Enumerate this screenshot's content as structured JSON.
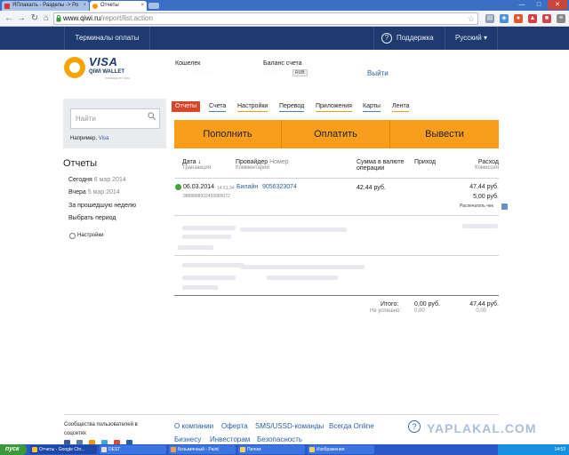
{
  "browser": {
    "tabs": [
      {
        "label": "ЯПлакалъ - Разделы -> Ро"
      },
      {
        "label": "Отчеты"
      }
    ],
    "url_host": "www.qiwi.ru",
    "url_path": "/report/list.action",
    "window_controls": {
      "minimize": "—",
      "maximize": "□",
      "close": "✕"
    }
  },
  "topbar": {
    "terminals": "Терминалы оплаты",
    "support": "Поддержка",
    "language": "Русский ▾"
  },
  "logo": {
    "brand": "VISA",
    "product": "QIWI WALLET",
    "powered": "POWERED BY QIWI"
  },
  "account": {
    "wallet_label": "Кошелек",
    "wallet_value": "· · · · · · ·",
    "balance_label": "Баланс счета",
    "balance_value": "· · · · ·",
    "currency": "RUB",
    "logout": "Выйти"
  },
  "search": {
    "placeholder": "Найти",
    "example_prefix": "Например,",
    "example_link": "Visa"
  },
  "left": {
    "heading": "Отчеты",
    "today": "Сегодня",
    "today_date": "6 мар 2014",
    "yesterday": "Вчера",
    "yesterday_date": "5 мар 2014",
    "last_week": "За прошедшую неделю",
    "choose_period": "Выбрать период",
    "settings": "Настройки"
  },
  "tabs": [
    "Отчеты",
    "Счета",
    "Настройки",
    "Перевод",
    "Приложения",
    "Карты",
    "Лента"
  ],
  "actions": {
    "topup": "Пополнить",
    "pay": "Оплатить",
    "withdraw": "Вывести"
  },
  "table": {
    "col_date": "Дата ↓",
    "col_date_sub": "Транзакция",
    "col_provider": "Провайдер",
    "col_provider_num": "Номер",
    "col_provider_sub": "Комментарий",
    "col_sum": "Сумма в валюте операции",
    "col_income": "Приход",
    "col_expense": "Расход",
    "col_expense_sub": "Комиссия",
    "row": {
      "date": "06.03.2014",
      "time": "14:51:34",
      "txn": "9888888002455886072",
      "provider": "Билайн",
      "number": "9056323074",
      "sum": "42,44 руб.",
      "expense": "47,44 руб.",
      "commission": "5,00 руб.",
      "print": "Распечатать чек"
    },
    "totals_label": "Итого:",
    "failed_label": "Не успешно:",
    "total_income": "0,00 руб.",
    "total_income_failed": "0,00",
    "total_expense": "47,44 руб.",
    "total_expense_failed": "0,00"
  },
  "footer": {
    "community": "Сообщества пользователей в соцсетях",
    "links_row1": [
      "О компании",
      "Оферта",
      "SMS/USSD-команды",
      "Всегда Online"
    ],
    "links_row2": [
      "Бизнесу",
      "Инвесторам",
      "Безопасность"
    ],
    "watermark": "YAPLAKAL.COM"
  },
  "taskbar": {
    "start": "пуск",
    "tasks": [
      "Отчеты - Google Chr...",
      "DEST",
      "Безымянный - Paint",
      "Пилим",
      "Изображения"
    ],
    "clock": "14:52"
  }
}
